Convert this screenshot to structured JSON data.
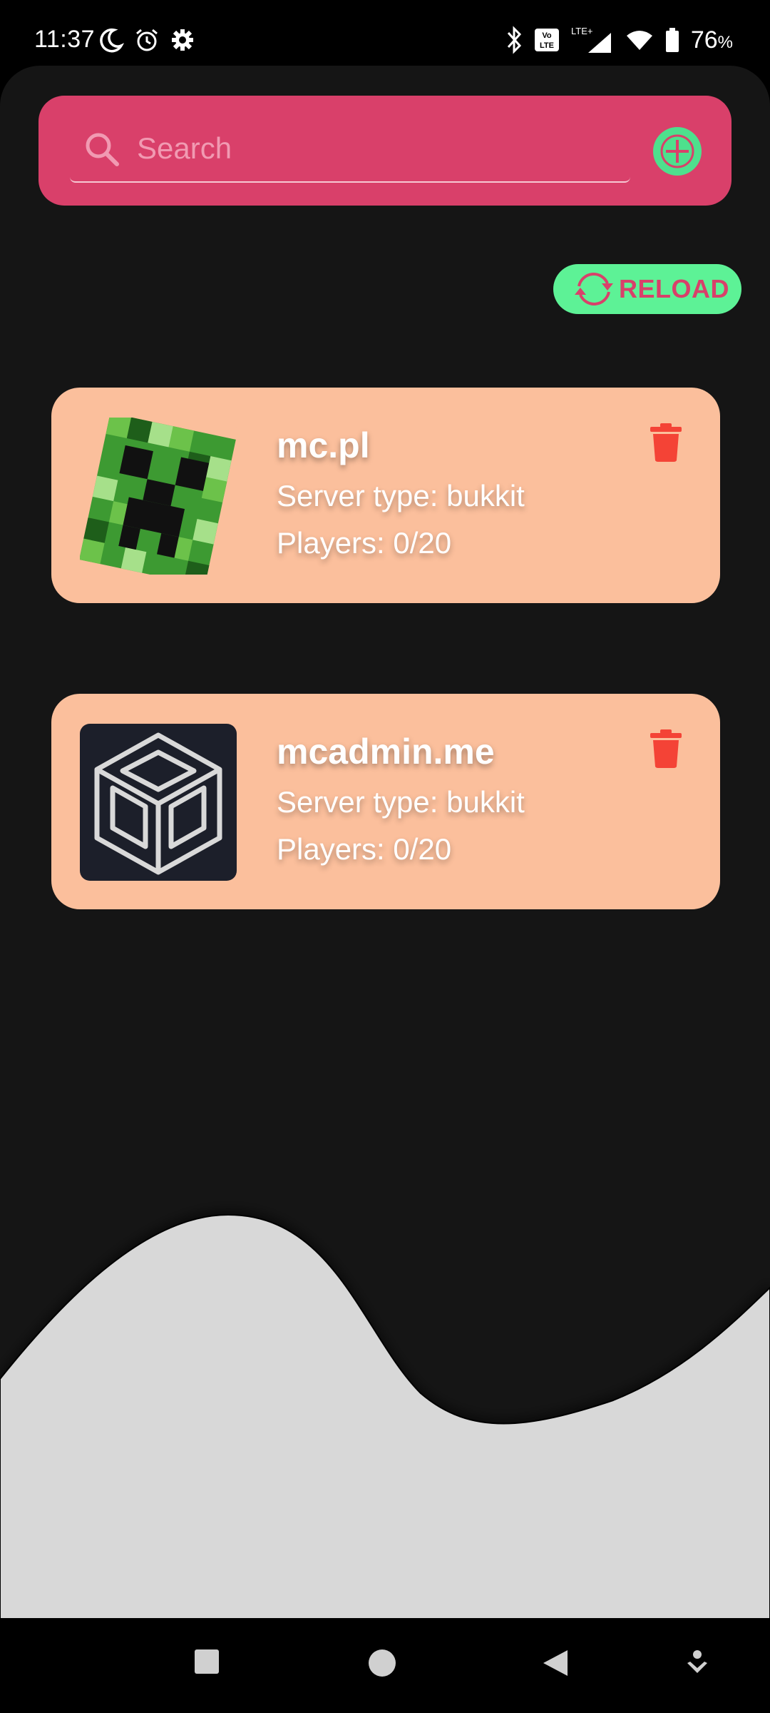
{
  "status_bar": {
    "time": "11:37",
    "battery_percent": "76",
    "battery_unit": "%"
  },
  "search": {
    "placeholder": "Search",
    "value": ""
  },
  "reload": {
    "label": "RELOAD"
  },
  "servers": [
    {
      "name": "mc.pl",
      "type": "Server type: bukkit",
      "players": "Players: 0/20",
      "icon": "creeper-face-icon"
    },
    {
      "name": "mcadmin.me",
      "type": "Server type: bukkit",
      "players": "Players: 0/20",
      "icon": "cube-logo-icon"
    }
  ],
  "colors": {
    "search_bar": "#d9406a",
    "accent_green": "#5df296",
    "card": "#fbbf9c",
    "delete": "#f44336",
    "background": "#151515",
    "wave": "#d8d8d8"
  }
}
